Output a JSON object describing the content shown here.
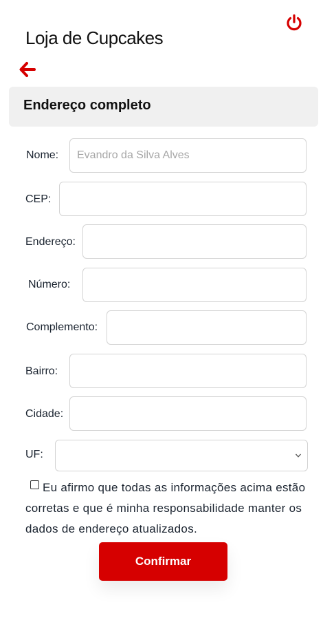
{
  "app": {
    "title": "Loja de Cupcakes"
  },
  "icons": {
    "power": "power-icon",
    "back": "arrow-left-icon",
    "chevron": "chevron-down-icon"
  },
  "colors": {
    "accent": "#d60000",
    "header_bg": "#f0f0f0"
  },
  "section": {
    "title": "Endereço completo"
  },
  "form": {
    "nome": {
      "label": "Nome:",
      "placeholder": "Evandro da Silva Alves",
      "value": ""
    },
    "cep": {
      "label": "CEP:",
      "value": ""
    },
    "endereco": {
      "label": "Endereço:",
      "value": ""
    },
    "numero": {
      "label": "Número:",
      "value": ""
    },
    "complemento": {
      "label": "Complemento:",
      "value": ""
    },
    "bairro": {
      "label": "Bairro:",
      "value": ""
    },
    "cidade": {
      "label": "Cidade:",
      "value": ""
    },
    "uf": {
      "label": "UF:",
      "value": ""
    },
    "agree_text": "Eu afirmo que todas as informações acima estão corretas e que é minha responsabilidade manter os dados de endereço atualizados.",
    "agree_checked": false,
    "confirm_label": "Confirmar"
  }
}
